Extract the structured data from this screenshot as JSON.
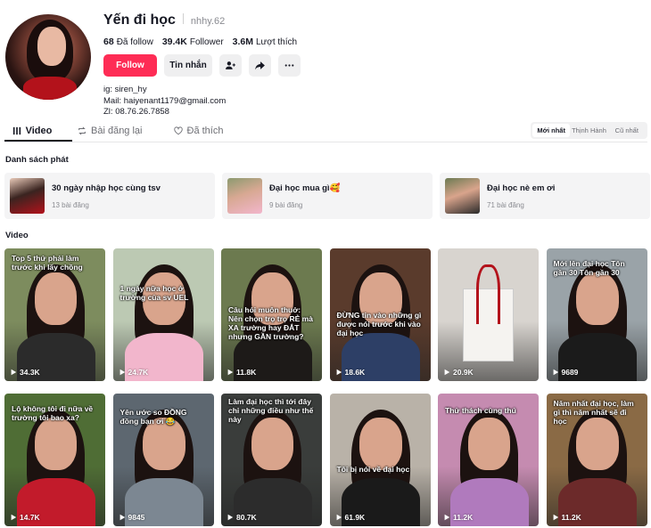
{
  "profile": {
    "name": "Yến đi học",
    "handle": "nhhy.62",
    "stats": [
      {
        "value": "68",
        "label": "Đã follow"
      },
      {
        "value": "39.4K",
        "label": "Follower"
      },
      {
        "value": "3.6M",
        "label": "Lượt thích"
      }
    ],
    "follow_label": "Follow",
    "message_label": "Tin nhắn",
    "bio": [
      "ig: siren_hy",
      "Mail: haiyenant1179@gmail.com",
      "Zl: 08.76.26.7858"
    ]
  },
  "tabs": [
    {
      "label": "Video",
      "icon": "grid-icon",
      "active": true
    },
    {
      "label": "Bài đăng lại",
      "icon": "repost-icon",
      "active": false
    },
    {
      "label": "Đã thích",
      "icon": "heart-outline-icon",
      "active": false
    }
  ],
  "sort": [
    "Mới nhất",
    "Thịnh Hành",
    "Cũ nhất"
  ],
  "playlist_title": "Danh sách phát",
  "playlists": [
    {
      "title": "30 ngày nhập học cùng tsv",
      "count": "13 bài đăng"
    },
    {
      "title": "Đại học mua gì🥰",
      "count": "9 bài đăng"
    },
    {
      "title": "Đại học nè em ơi",
      "count": "71 bài đăng"
    }
  ],
  "video_title": "Video",
  "videos": [
    {
      "plays": "34.3K",
      "caption": "Top 5 thứ phải làm trước khi lấy chồng",
      "bg": "#7d8c5e",
      "shirt": "#2b2b2b"
    },
    {
      "plays": "24.7K",
      "caption": "1 ngày nữa học ở trường của sv UEL",
      "bg": "#bcc9b3",
      "shirt": "#f2b6cc"
    },
    {
      "plays": "11.8K",
      "caption": "Câu hỏi muôn thuở: Nên chọn trọ trọ RẺ mà XA trường hay ĐẮT nhưng GẦN trường?",
      "bg": "#6c7a4f",
      "shirt": "#1d1a18"
    },
    {
      "plays": "18.6K",
      "caption": "ĐỪNG tin vào những gì được nói trước khi vào đại học",
      "bg": "#5a3b2c",
      "shirt": "#2d3f66"
    },
    {
      "plays": "20.9K",
      "caption": "",
      "bg": "#d8d4cf",
      "shirt": "#ffffff"
    },
    {
      "plays": "9689",
      "caption": "Mới lên đại học Tôn gần 30 Tôn gần 30",
      "bg": "#9aa3a8",
      "shirt": "#1b1b1b"
    },
    {
      "plays": "14.7K",
      "caption": "Lộ không tôi đi nữa về trường tôi bao xa?",
      "bg": "#4f6d35",
      "shirt": "#c21b2b"
    },
    {
      "plays": "9845",
      "caption": "Yên ước so ĐỒNG đồng bạn ơi 😂",
      "bg": "#5d6770",
      "shirt": "#7c8792"
    },
    {
      "plays": "80.7K",
      "caption": "Làm đại học thì tới đây chỉ những điều như thế này",
      "bg": "#3a3d3b",
      "shirt": "#2c2c2c"
    },
    {
      "plays": "61.9K",
      "caption": "Tôi bị nói về đại học",
      "bg": "#b9b2a8",
      "shirt": "#1a1a1a"
    },
    {
      "plays": "11.2K",
      "caption": "Thử thách cùng thú",
      "bg": "#c58bb0",
      "shirt": "#b07abd"
    },
    {
      "plays": "11.2K",
      "caption": "Năm nhất đại học, làm gì thì năm nhất sẽ đi học",
      "bg": "#8a6a45",
      "shirt": "#6c2a2a"
    }
  ]
}
